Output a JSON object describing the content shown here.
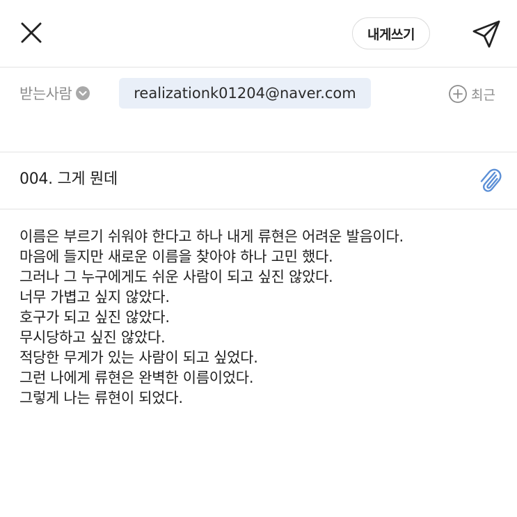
{
  "header": {
    "self_write_label": "내게쓰기"
  },
  "recipient": {
    "label": "받는사람",
    "email": "realizationk01204@naver.com",
    "recent_label": "최근"
  },
  "subject": {
    "text": "004. 그게 뭔데"
  },
  "body": {
    "lines": [
      "이름은 부르기 쉬워야 한다고 하나 내게 류현은 어려운 발음이다.",
      "마음에 들지만 새로운 이름을 찾아야 하나 고민 했다.",
      "그러나 그 누구에게도 쉬운 사람이 되고 싶진 않았다.",
      "너무 가볍고 싶지 않았다.",
      "호구가 되고 싶진 않았다.",
      "무시당하고 싶진 않았다.",
      "적당한 무게가 있는 사람이 되고 싶었다.",
      "그런 나에게 류현은 완벽한 이름이었다.",
      "그렇게 나는 류현이 되었다."
    ]
  },
  "icons": {
    "close": "close-icon",
    "send": "paper-plane-icon",
    "chevron": "chevron-down-circle-icon",
    "add": "plus-circle-icon",
    "attach": "paperclip-icon"
  },
  "colors": {
    "chip_bg": "#e9eff8",
    "attach_blue": "#5b8fd6",
    "muted_text": "#8c8c8c"
  }
}
